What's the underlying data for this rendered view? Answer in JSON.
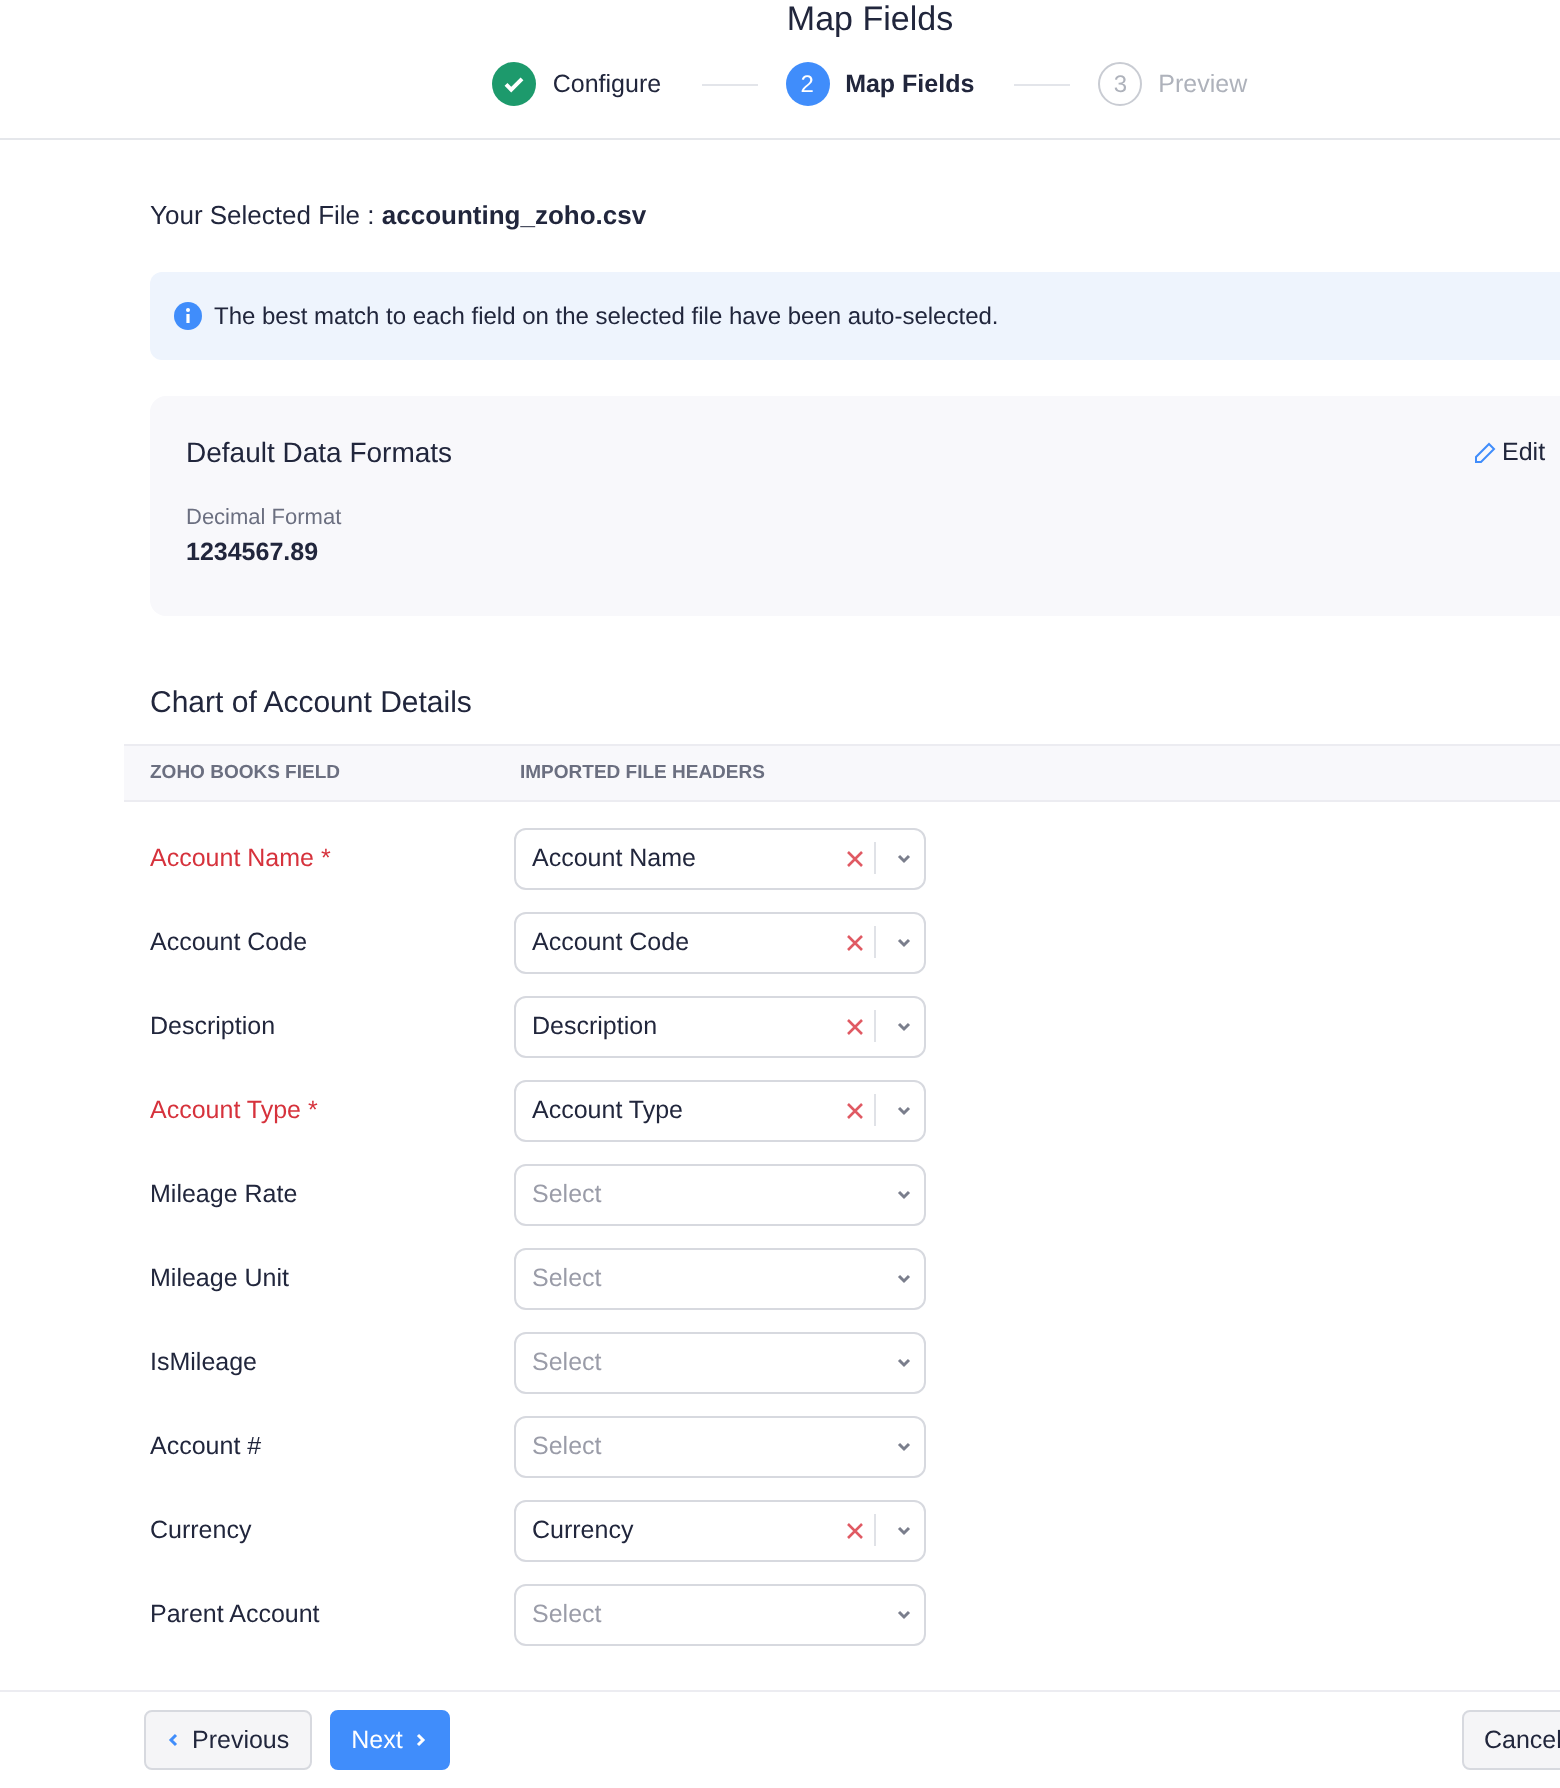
{
  "title": "Map Fields",
  "steps": [
    {
      "label": "Configure",
      "done": true,
      "selected": false
    },
    {
      "number": "2",
      "label": "Map Fields",
      "done": false,
      "selected": true
    },
    {
      "number": "3",
      "label": "Preview",
      "done": false,
      "selected": false
    }
  ],
  "selected_file": {
    "label": "Your Selected File :",
    "name": "accounting_zoho.csv"
  },
  "info_banner": "The best match to each field on the selected file have been auto-selected.",
  "formats_card": {
    "title": "Default Data Formats",
    "edit": "Edit",
    "field_label": "Decimal Format",
    "field_value": "1234567.89"
  },
  "section_title": "Chart of Account Details",
  "columns": [
    "ZOHO BOOKS FIELD",
    "IMPORTED FILE HEADERS"
  ],
  "rows": [
    {
      "field": "Account Name *",
      "required": true,
      "value": "Account Name"
    },
    {
      "field": "Account Code",
      "required": false,
      "value": "Account Code"
    },
    {
      "field": "Description",
      "required": false,
      "value": "Description"
    },
    {
      "field": "Account Type *",
      "required": true,
      "value": "Account Type"
    },
    {
      "field": "Mileage Rate",
      "required": false,
      "placeholder": "Select"
    },
    {
      "field": "Mileage Unit",
      "required": false,
      "placeholder": "Select"
    },
    {
      "field": "IsMileage",
      "required": false,
      "placeholder": "Select"
    },
    {
      "field": "Account #",
      "required": false,
      "placeholder": "Select"
    },
    {
      "field": "Currency",
      "required": false,
      "value": "Currency"
    },
    {
      "field": "Parent Account",
      "required": false,
      "placeholder": "Select"
    }
  ],
  "footer": {
    "previous": "Previous",
    "next": "Next",
    "cancel": "Cancel"
  }
}
